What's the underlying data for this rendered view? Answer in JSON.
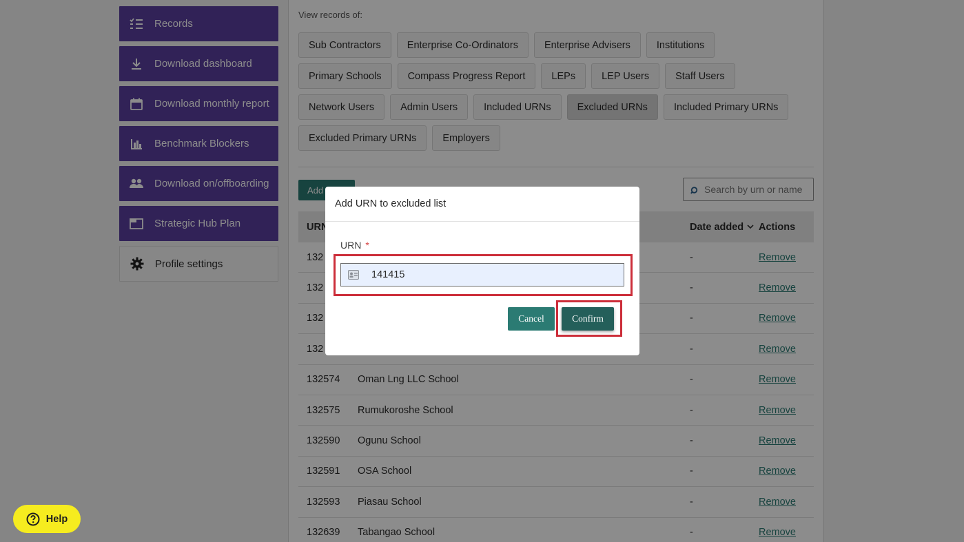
{
  "sidebar": {
    "items": [
      {
        "label": "Records",
        "icon": "records-list-icon"
      },
      {
        "label": "Download dashboard",
        "icon": "download-icon"
      },
      {
        "label": "Download monthly report",
        "icon": "calendar-icon"
      },
      {
        "label": "Benchmark Blockers",
        "icon": "bar-chart-icon"
      },
      {
        "label": "Download on/offboarding",
        "icon": "people-icon"
      },
      {
        "label": "Strategic Hub Plan",
        "icon": "window-icon"
      },
      {
        "label": "Profile settings",
        "icon": "gear-icon"
      }
    ]
  },
  "filters": {
    "label": "View records of:",
    "rows": [
      [
        "Sub Contractors",
        "Enterprise Co-Ordinators",
        "Enterprise Advisers",
        "Institutions"
      ],
      [
        "Primary Schools",
        "Compass Progress Report",
        "LEPs",
        "LEP Users",
        "Staff Users"
      ],
      [
        "Network Users",
        "Admin Users",
        "Included URNs",
        "Excluded URNs",
        "Included Primary URNs"
      ],
      [
        "Excluded Primary URNs",
        "Employers"
      ]
    ],
    "active": "Excluded URNs"
  },
  "toolbar": {
    "add_label": "Add",
    "search_placeholder": "Search by urn or name"
  },
  "table": {
    "headers": {
      "urn": "URN",
      "date": "Date added",
      "actions": "Actions"
    },
    "rows": [
      {
        "urn": "132",
        "name": "",
        "date": "-",
        "action": "Remove"
      },
      {
        "urn": "132",
        "name": "",
        "date": "-",
        "action": "Remove"
      },
      {
        "urn": "132",
        "name": "",
        "date": "-",
        "action": "Remove"
      },
      {
        "urn": "132",
        "name": "",
        "date": "-",
        "action": "Remove"
      },
      {
        "urn": "132574",
        "name": "Oman Lng LLC School",
        "date": "-",
        "action": "Remove"
      },
      {
        "urn": "132575",
        "name": "Rumukoroshe School",
        "date": "-",
        "action": "Remove"
      },
      {
        "urn": "132590",
        "name": "Ogunu School",
        "date": "-",
        "action": "Remove"
      },
      {
        "urn": "132591",
        "name": "OSA School",
        "date": "-",
        "action": "Remove"
      },
      {
        "urn": "132593",
        "name": "Piasau School",
        "date": "-",
        "action": "Remove"
      },
      {
        "urn": "132639",
        "name": "Tabangao School",
        "date": "-",
        "action": "Remove"
      }
    ]
  },
  "modal": {
    "title": "Add URN to excluded list",
    "field_label": "URN",
    "required_mark": "*",
    "urn_value": "141415",
    "cancel_label": "Cancel",
    "confirm_label": "Confirm"
  },
  "help": {
    "label": "Help"
  },
  "colors": {
    "sidebar_purple": "#5a3e9e",
    "teal": "#2b7b73",
    "highlight_red": "#cc2e3a",
    "help_yellow": "#f6ec1f"
  }
}
